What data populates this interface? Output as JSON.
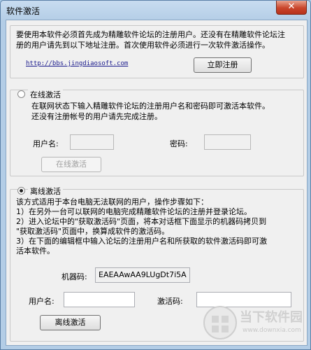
{
  "window": {
    "title": "软件激活",
    "close_glyph": "✕"
  },
  "register": {
    "notice_lines": [
      "要使用本软件必须首先成为精雕软件论坛的注册用户。还没有在精雕软件论坛注",
      "册的用户请先到以下地址注册。首次使用软件必须进行一次软件激活操作。"
    ],
    "url": "http://bbs.jingdiaosoft.com",
    "register_button": "立即注册"
  },
  "online": {
    "label": "在线激活",
    "selected": false,
    "desc_lines": [
      "在联网状态下输入精雕软件论坛的注册用户名和密码即可激活本软件。",
      "还没有注册帐号的用户请先完成注册。"
    ],
    "username_label": "用户名:",
    "username_value": "",
    "password_label": "密码:",
    "password_value": "",
    "activate_button": "在线激活"
  },
  "offline": {
    "label": "离线激活",
    "selected": true,
    "desc_lines": [
      "该方式适用于本台电脑无法联网的用户，操作步骤如下：",
      "1）在另外一台可以联网的电脑完成精雕软件论坛的注册并登录论坛。",
      "2）进入论坛中的\"获取激活码\"页面，将本对话框下面显示的机器码拷贝到",
      "\"获取激活码\"页面中，换算成软件的激活码。",
      "3）在下面的编辑框中输入论坛的注册用户名和所获取的软件激活码即可激",
      "活本软件。"
    ],
    "machine_code_label": "机器码:",
    "machine_code_value": "EAEAAwAA9LUgDt7i5A",
    "username_label": "用户名:",
    "username_value": "",
    "activation_code_label": "激活码:",
    "activation_code_value": "",
    "activate_button": "离线激活"
  },
  "watermark": {
    "brand": "当下软件园",
    "site": "www.downxia.com"
  }
}
